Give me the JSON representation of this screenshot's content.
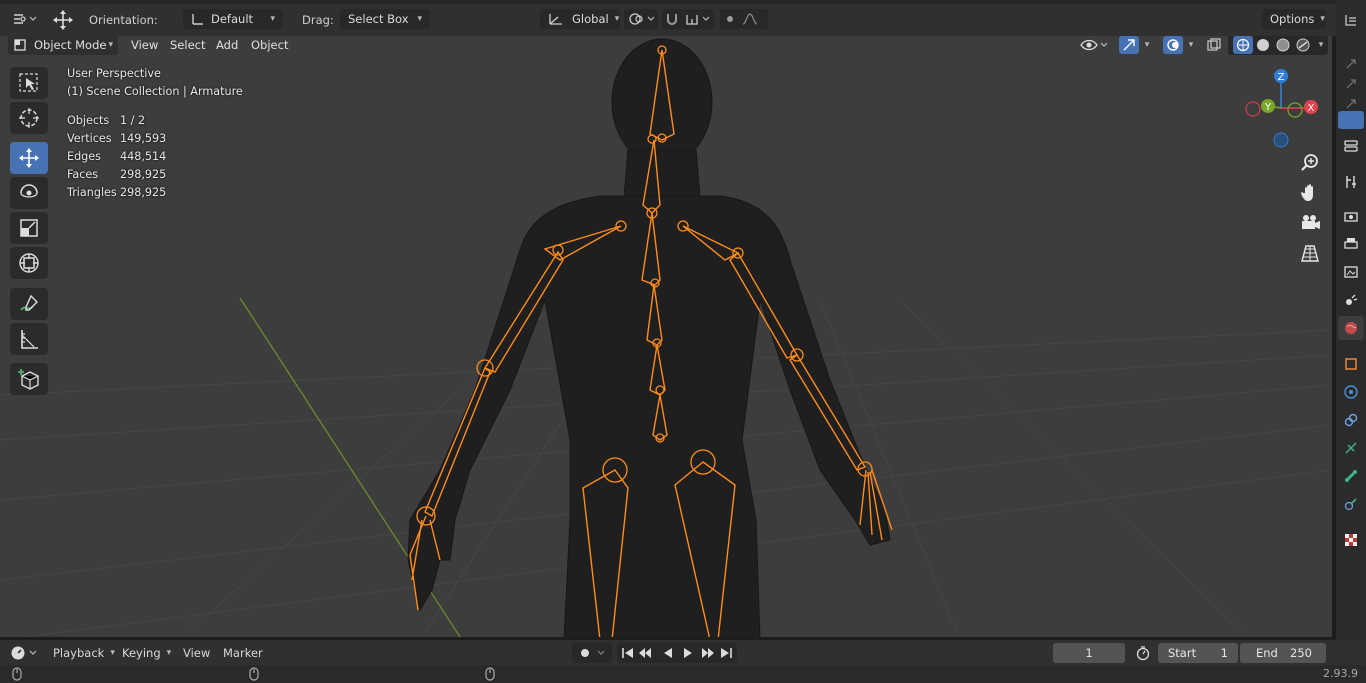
{
  "tool_header": {
    "orientation_label": "Orientation:",
    "orientation_value": "Default",
    "drag_label": "Drag:",
    "drag_value": "Select Box",
    "transform_orientation": "Global",
    "options_label": "Options"
  },
  "viewport_header": {
    "mode": "Object Mode",
    "menus": [
      "View",
      "Select",
      "Add",
      "Object"
    ]
  },
  "overlay": {
    "perspective": "User Perspective",
    "collection": "(1) Scene Collection | Armature",
    "stats": [
      {
        "label": "Objects",
        "value": "1 / 2"
      },
      {
        "label": "Vertices",
        "value": "149,593"
      },
      {
        "label": "Edges",
        "value": "448,514"
      },
      {
        "label": "Faces",
        "value": "298,925"
      },
      {
        "label": "Triangles",
        "value": "298,925"
      }
    ]
  },
  "gizmo": {
    "z": "Z",
    "y": "Y",
    "x": "X"
  },
  "timeline": {
    "menus": [
      "Playback",
      "Keying",
      "View",
      "Marker"
    ],
    "current_frame": "1",
    "start_label": "Start",
    "start_value": "1",
    "end_label": "End",
    "end_value": "250"
  },
  "status": {
    "version": "2.93.9"
  },
  "colors": {
    "bone": "#ff8c1a",
    "active_tool": "#4772b3",
    "axis_x": "#e3434f",
    "axis_y": "#7aa62a",
    "axis_z": "#2f7fd8"
  }
}
